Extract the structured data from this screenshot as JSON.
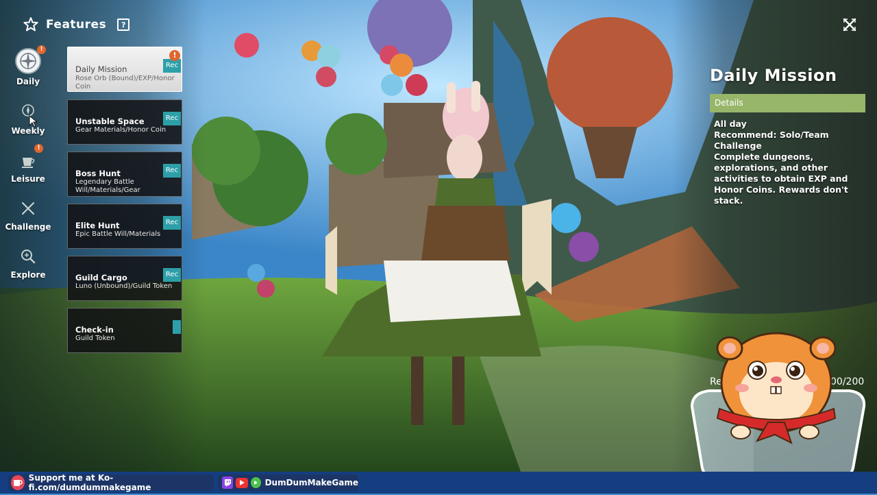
{
  "header": {
    "title": "Features",
    "help_icon": "?"
  },
  "nav": [
    {
      "label": "Daily",
      "icon": "compass-icon",
      "alert": "!"
    },
    {
      "label": "Weekly",
      "icon": "weekly-icon",
      "alert": ""
    },
    {
      "label": "Leisure",
      "icon": "cup-icon",
      "alert": "!"
    },
    {
      "label": "Challenge",
      "icon": "crossed-swords-icon",
      "alert": ""
    },
    {
      "label": "Explore",
      "icon": "magnifier-icon",
      "alert": ""
    }
  ],
  "missions": [
    {
      "name": "Daily Mission",
      "reward": "Rose Orb (Bound)/EXP/Honor Coin",
      "tag": "Rec",
      "alert": "!"
    },
    {
      "name": "Unstable Space",
      "reward": "Gear Materials/Honor Coin",
      "tag": "Rec"
    },
    {
      "name": "Boss Hunt",
      "reward": "Legendary Battle Will/Materials/Gear",
      "tag": "Rec"
    },
    {
      "name": "Elite Hunt",
      "reward": "Epic Battle Will/Materials",
      "tag": "Rec"
    },
    {
      "name": "Guild Cargo",
      "reward": "Luno (Unbound)/Guild Token",
      "tag": "Rec"
    },
    {
      "name": "Check-in",
      "reward": "Guild Token",
      "tag": ""
    }
  ],
  "detail": {
    "title": "Daily Mission",
    "section": "Details",
    "lines": [
      "All day",
      "Recommend: Solo/Team",
      "Challenge",
      "Complete dungeons, explorations, and other activities to obtain EXP and Honor Coins. Rewards don't stack."
    ],
    "progress_label": "Re",
    "progress_value": "00/200"
  },
  "footer": {
    "support_text": "Support me at Ko-fi.com/dumdummakegame",
    "channel_name": "DumDumMakeGame"
  },
  "colors": {
    "accent_teal": "#2d9fa9",
    "alert_orange": "#e0662e",
    "details_green": "#98b66a",
    "footer_blue": "#143e80"
  }
}
